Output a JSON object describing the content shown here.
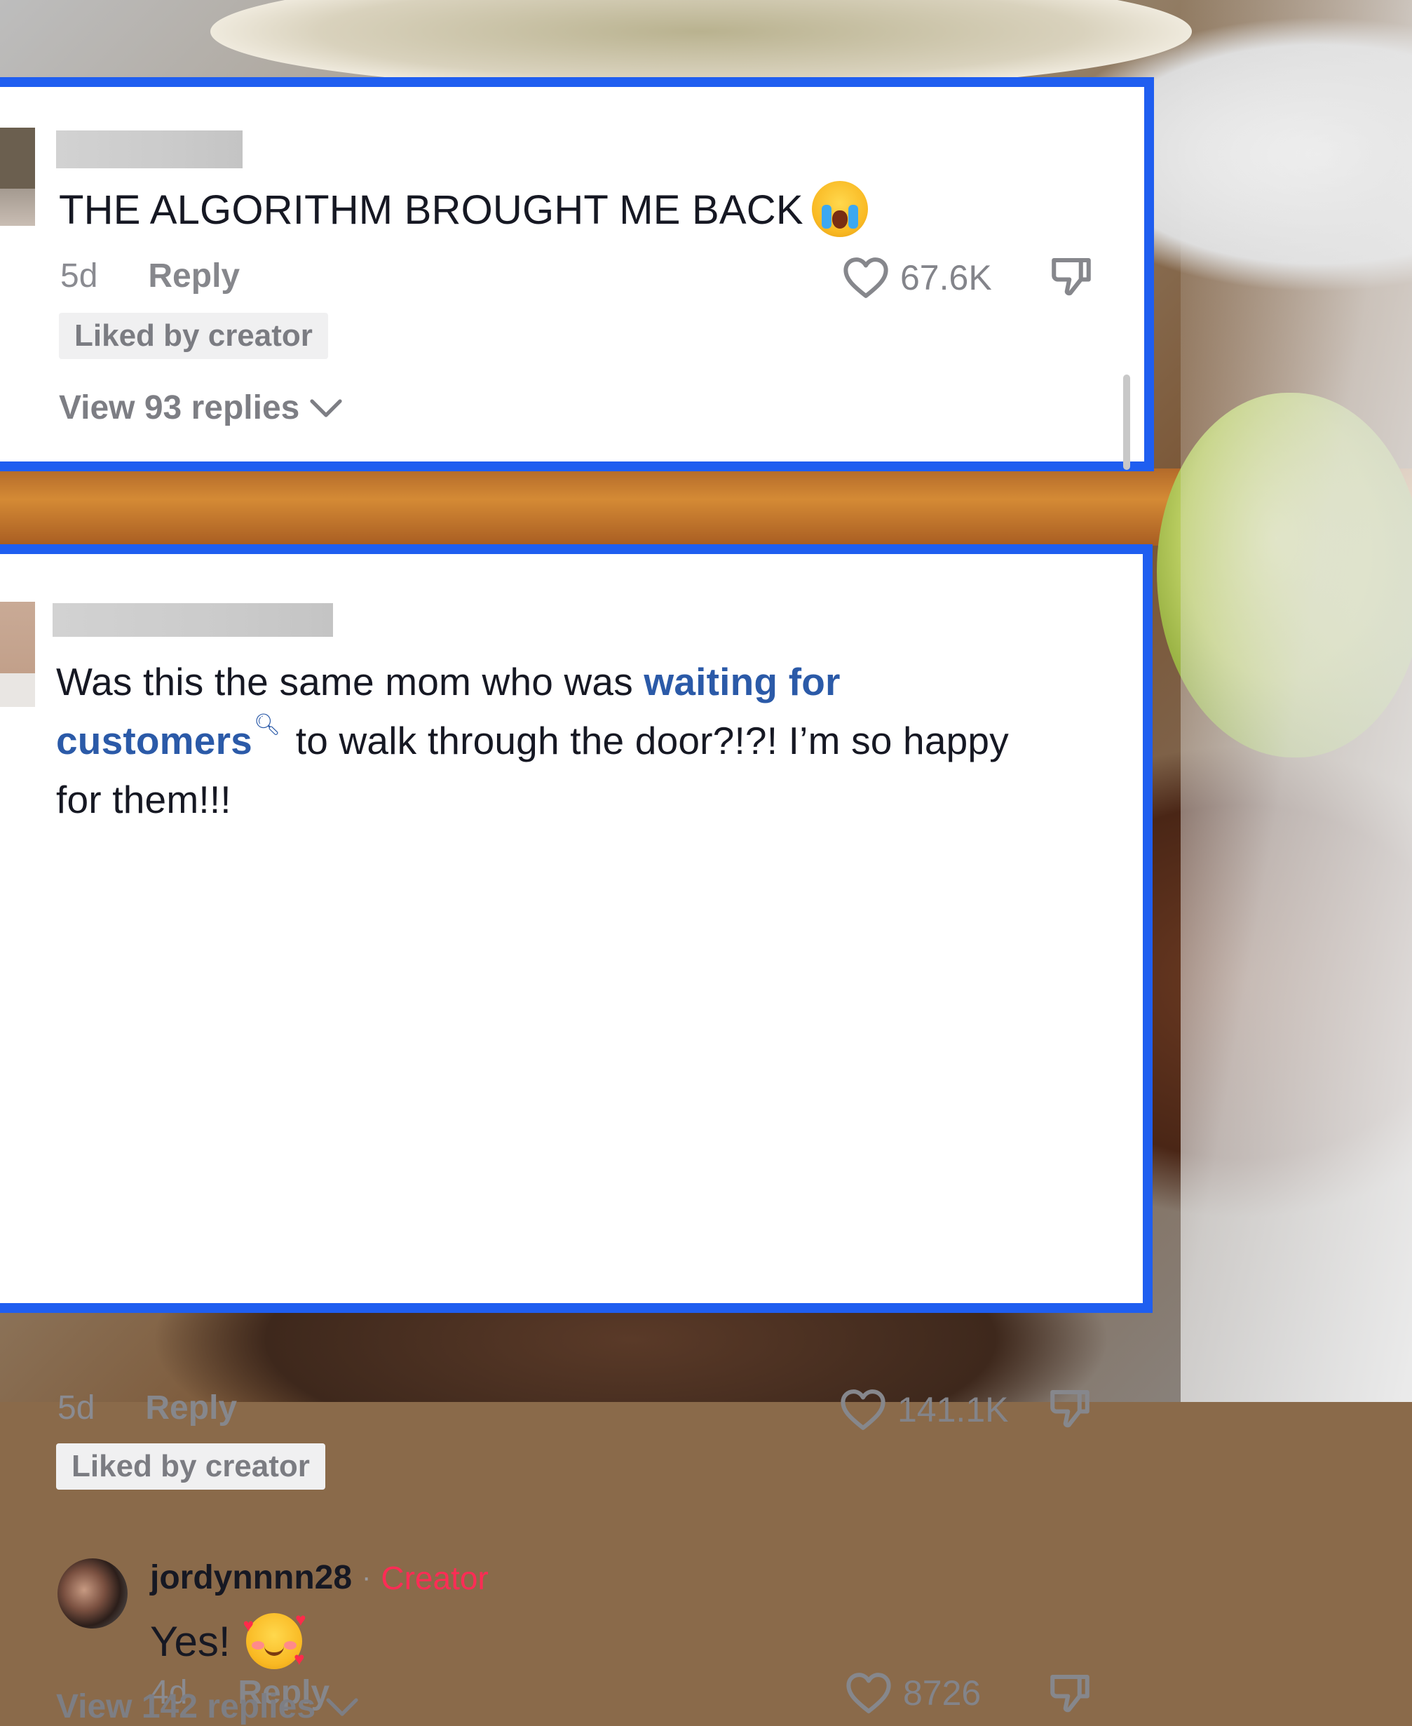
{
  "comment_1": {
    "text": "THE ALGORITHM BROUGHT ME BACK",
    "emoji": "loudly-crying-face",
    "age": "5d",
    "reply_label": "Reply",
    "likes": "67.6K",
    "liked_badge": "Liked by creator",
    "view_replies": "View 93 replies"
  },
  "comment_2": {
    "text_before": "Was this the same mom who was ",
    "link_text": "waiting for customers",
    "text_after": " to walk through the door?!?! I’m so happy for them!!!",
    "age": "5d",
    "reply_label": "Reply",
    "likes": "141.1K",
    "liked_badge": "Liked by creator",
    "view_replies": "View 142 replies",
    "creator_reply": {
      "username": "jordynnnn28",
      "separator": "·",
      "tag": "Creator",
      "text": "Yes!",
      "emoji": "smiling-face-with-hearts",
      "age": "4d",
      "reply_label": "Reply",
      "likes": "8726"
    }
  },
  "colors": {
    "panel_border": "#1f5ef0",
    "link": "#2b5aa8",
    "creator_tag": "#fe2c55",
    "text_primary": "#161823",
    "text_muted": "#86878c"
  }
}
